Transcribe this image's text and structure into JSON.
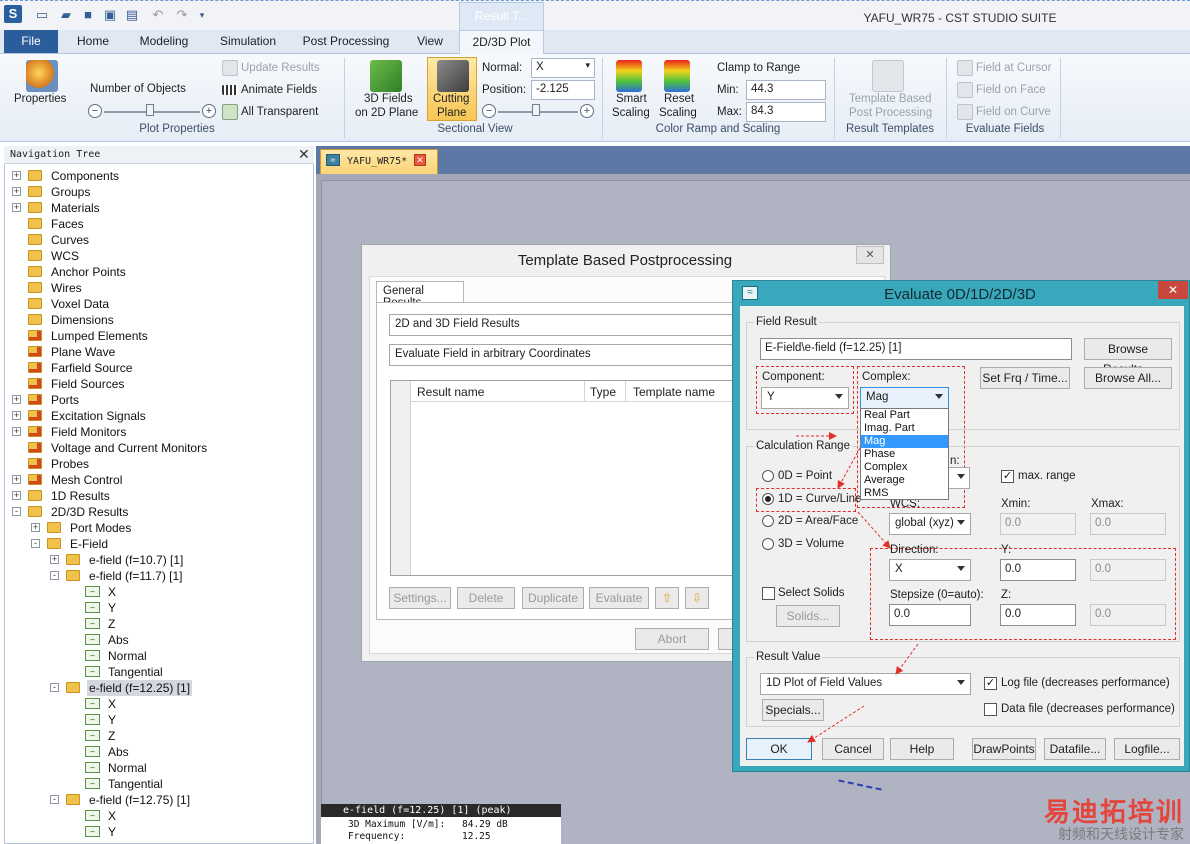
{
  "window": {
    "title": "YAFU_WR75 - CST STUDIO SUITE",
    "context_tab": "Result T..."
  },
  "ribbon_tabs": [
    "File",
    "Home",
    "Modeling",
    "Simulation",
    "Post Processing",
    "View",
    "2D/3D Plot"
  ],
  "ribbon": {
    "properties": "Properties",
    "number_of_objects": "Number of Objects",
    "update_results": "Update Results",
    "animate_fields": "Animate Fields",
    "all_transparent": "All Transparent",
    "plot_properties": "Plot Properties",
    "fields_2d_line1": "3D Fields",
    "fields_2d_line2": "on 2D Plane",
    "cutting_line1": "Cutting",
    "cutting_line2": "Plane",
    "normal_label": "Normal:",
    "normal_value": "X",
    "position_label": "Position:",
    "position_value": "-2.125",
    "sectional_view": "Sectional View",
    "smart_line1": "Smart",
    "smart_line2": "Scaling",
    "reset_line1": "Reset",
    "reset_line2": "Scaling",
    "clamp_to_range": "Clamp to Range",
    "min_label": "Min:",
    "min_value": "44.3",
    "max_label": "Max:",
    "max_value": "84.3",
    "color_ramp": "Color Ramp and Scaling",
    "tpl_line1": "Template Based",
    "tpl_line2": "Post Processing",
    "result_templates": "Result Templates",
    "field_at_cursor": "Field at Cursor",
    "field_on_face": "Field on Face",
    "field_on_curve": "Field on Curve",
    "evaluate_fields": "Evaluate Fields"
  },
  "nav": {
    "header": "Navigation Tree",
    "items": [
      {
        "label": "Components",
        "exp": "+",
        "indent": 0,
        "ico": "folder"
      },
      {
        "label": "Groups",
        "exp": "+",
        "indent": 0,
        "ico": "folder"
      },
      {
        "label": "Materials",
        "exp": "+",
        "indent": 0,
        "ico": "folder"
      },
      {
        "label": "Faces",
        "exp": "",
        "indent": 0,
        "ico": "folder"
      },
      {
        "label": "Curves",
        "exp": "",
        "indent": 0,
        "ico": "folder"
      },
      {
        "label": "WCS",
        "exp": "",
        "indent": 0,
        "ico": "folder"
      },
      {
        "label": "Anchor Points",
        "exp": "",
        "indent": 0,
        "ico": "folder"
      },
      {
        "label": "Wires",
        "exp": "",
        "indent": 0,
        "ico": "folder"
      },
      {
        "label": "Voxel Data",
        "exp": "",
        "indent": 0,
        "ico": "folder"
      },
      {
        "label": "Dimensions",
        "exp": "",
        "indent": 0,
        "ico": "folder"
      },
      {
        "label": "Lumped Elements",
        "exp": "",
        "indent": 0,
        "ico": "gear"
      },
      {
        "label": "Plane Wave",
        "exp": "",
        "indent": 0,
        "ico": "gear"
      },
      {
        "label": "Farfield Source",
        "exp": "",
        "indent": 0,
        "ico": "gear"
      },
      {
        "label": "Field Sources",
        "exp": "",
        "indent": 0,
        "ico": "gear"
      },
      {
        "label": "Ports",
        "exp": "+",
        "indent": 0,
        "ico": "gear"
      },
      {
        "label": "Excitation Signals",
        "exp": "+",
        "indent": 0,
        "ico": "gear"
      },
      {
        "label": "Field Monitors",
        "exp": "+",
        "indent": 0,
        "ico": "gear"
      },
      {
        "label": "Voltage and Current Monitors",
        "exp": "",
        "indent": 0,
        "ico": "gear"
      },
      {
        "label": "Probes",
        "exp": "",
        "indent": 0,
        "ico": "gear"
      },
      {
        "label": "Mesh Control",
        "exp": "+",
        "indent": 0,
        "ico": "gear"
      },
      {
        "label": "1D Results",
        "exp": "+",
        "indent": 0,
        "ico": "folder"
      },
      {
        "label": "2D/3D Results",
        "exp": "-",
        "indent": 0,
        "ico": "folder"
      },
      {
        "label": "Port Modes",
        "exp": "+",
        "indent": 1,
        "ico": "folder"
      },
      {
        "label": "E-Field",
        "exp": "-",
        "indent": 1,
        "ico": "folder"
      },
      {
        "label": "e-field (f=10.7) [1]",
        "exp": "+",
        "indent": 2,
        "ico": "folder"
      },
      {
        "label": "e-field (f=11.7) [1]",
        "exp": "-",
        "indent": 2,
        "ico": "folder"
      },
      {
        "label": "X",
        "exp": "",
        "indent": 3,
        "ico": "leaf"
      },
      {
        "label": "Y",
        "exp": "",
        "indent": 3,
        "ico": "leaf"
      },
      {
        "label": "Z",
        "exp": "",
        "indent": 3,
        "ico": "leaf"
      },
      {
        "label": "Abs",
        "exp": "",
        "indent": 3,
        "ico": "leaf"
      },
      {
        "label": "Normal",
        "exp": "",
        "indent": 3,
        "ico": "leaf"
      },
      {
        "label": "Tangential",
        "exp": "",
        "indent": 3,
        "ico": "leaf"
      },
      {
        "label": "e-field (f=12.25) [1]",
        "exp": "-",
        "indent": 2,
        "ico": "folder",
        "selected": true
      },
      {
        "label": "X",
        "exp": "",
        "indent": 3,
        "ico": "leaf"
      },
      {
        "label": "Y",
        "exp": "",
        "indent": 3,
        "ico": "leaf"
      },
      {
        "label": "Z",
        "exp": "",
        "indent": 3,
        "ico": "leaf"
      },
      {
        "label": "Abs",
        "exp": "",
        "indent": 3,
        "ico": "leaf"
      },
      {
        "label": "Normal",
        "exp": "",
        "indent": 3,
        "ico": "leaf"
      },
      {
        "label": "Tangential",
        "exp": "",
        "indent": 3,
        "ico": "leaf"
      },
      {
        "label": "e-field (f=12.75) [1]",
        "exp": "-",
        "indent": 2,
        "ico": "folder"
      },
      {
        "label": "X",
        "exp": "",
        "indent": 3,
        "ico": "leaf"
      },
      {
        "label": "Y",
        "exp": "",
        "indent": 3,
        "ico": "leaf"
      }
    ]
  },
  "doc_tab": "YAFU_WR75*",
  "template_dialog": {
    "title": "Template Based Postprocessing",
    "tab": "General Results",
    "combo1": "2D and 3D Field Results",
    "combo2": "Evaluate Field in arbitrary Coordinates",
    "col_result": "Result name",
    "col_type": "Type",
    "col_template": "Template name",
    "btn_settings": "Settings...",
    "btn_delete": "Delete",
    "btn_duplicate": "Duplicate",
    "btn_evaluate": "Evaluate",
    "btn_abort": "Abort"
  },
  "eval_dialog": {
    "title": "Evaluate 0D/1D/2D/3D",
    "field_result": "Field Result",
    "field_value": "E-Field\\e-field (f=12.25) [1]",
    "browse_results": "Browse Results...",
    "component_label": "Component:",
    "component_value": "Y",
    "complex_label": "Complex:",
    "complex_value": "Mag",
    "set_frq": "Set Frq / Time...",
    "browse_all": "Browse All...",
    "complex_options": [
      "Real Part",
      "Imag. Part",
      "Mag",
      "Phase",
      "Complex",
      "Average",
      "RMS"
    ],
    "calc_range": "Calculation Range",
    "r0d": "0D = Point",
    "r1d": "1D = Curve/Line",
    "r2d": "2D = Area/Face",
    "r3d": "3D = Volume",
    "partial_label": "n:",
    "max_range": "max. range",
    "wcs_label": "WCS:",
    "wcs_value": "global (xyz)",
    "xmin": "Xmin:",
    "xmax": "Xmax:",
    "xmin_val": "0.0",
    "xmax_val": "0.0",
    "direction_label": "Direction:",
    "direction_value": "X",
    "y_label": "Y:",
    "y_val": "0.0",
    "y_val2": "0.0",
    "stepsize_label": "Stepsize (0=auto):",
    "stepsize_val": "0.0",
    "z_label": "Z:",
    "z_val": "0.0",
    "z_val2": "0.0",
    "select_solids": "Select Solids",
    "solids_btn": "Solids...",
    "result_value": "Result Value",
    "result_value_combo": "1D Plot of Field Values",
    "log_file": "Log file (decreases performance)",
    "data_file": "Data file (decreases performance)",
    "specials": "Specials...",
    "ok": "OK",
    "cancel": "Cancel",
    "help": "Help",
    "drawpoints": "DrawPoints",
    "datafile": "Datafile...",
    "logfile": "Logfile..."
  },
  "info": {
    "title": "e-field (f=12.25) [1] (peak)",
    "max_label": "3D Maximum [V/m]:",
    "max_value": "84.29 dB",
    "freq_label": "Frequency:",
    "freq_value": "12.25"
  },
  "watermark": {
    "line1": "易迪拓培训",
    "line2": "射频和天线设计专家"
  }
}
